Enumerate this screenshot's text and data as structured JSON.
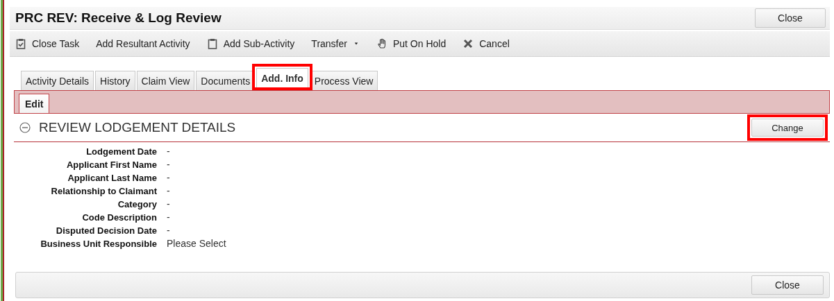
{
  "window": {
    "title": "PRC REV: Receive & Log Review",
    "close_button": "Close"
  },
  "toolbar": [
    {
      "label": "Close Task"
    },
    {
      "label": "Add Resultant Activity"
    },
    {
      "label": "Add Sub-Activity"
    },
    {
      "label": "Transfer"
    },
    {
      "label": "Put On Hold"
    },
    {
      "label": "Cancel"
    }
  ],
  "tabs": [
    {
      "label": "Activity Details",
      "selected": false,
      "highlighted": false
    },
    {
      "label": "History",
      "selected": false,
      "highlighted": false
    },
    {
      "label": "Claim View",
      "selected": false,
      "highlighted": false
    },
    {
      "label": "Documents",
      "selected": false,
      "highlighted": false
    },
    {
      "label": "Add. Info",
      "selected": true,
      "highlighted": true
    },
    {
      "label": "Process View",
      "selected": false,
      "highlighted": false
    }
  ],
  "subtabs": [
    {
      "label": "Edit",
      "selected": true
    }
  ],
  "section": {
    "title": "REVIEW LODGEMENT DETAILS",
    "expanded": true,
    "button": {
      "label": "Change",
      "highlighted": true
    }
  },
  "fields": [
    {
      "label": "Lodgement Date",
      "value": "-"
    },
    {
      "label": "Applicant First Name",
      "value": "-"
    },
    {
      "label": "Applicant Last Name",
      "value": "-"
    },
    {
      "label": "Relationship to Claimant",
      "value": "-"
    },
    {
      "label": "Category",
      "value": "-"
    },
    {
      "label": "Code Description",
      "value": "-"
    },
    {
      "label": "Disputed Decision Date",
      "value": "-"
    },
    {
      "label": "Business Unit Responsible",
      "value": "Please Select"
    }
  ],
  "footer": {
    "button": "Close"
  }
}
